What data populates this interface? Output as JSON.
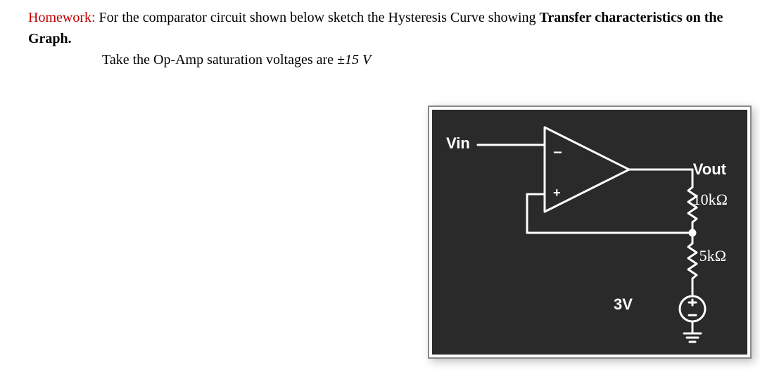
{
  "problem": {
    "hw_label": "Homework:",
    "line1a": " For the comparator circuit shown below sketch the Hysteresis Curve showing ",
    "line1b": "Transfer characteristics on the Graph.",
    "line2a": "Take the Op-Amp saturation voltages are ",
    "line2b": "±15 V"
  },
  "circuit": {
    "vin": "Vin",
    "vout": "Vout",
    "r_feedback": "10kΩ",
    "r_ground": "5kΩ",
    "v_ref": "3V",
    "plus": "+",
    "minus": "−"
  }
}
